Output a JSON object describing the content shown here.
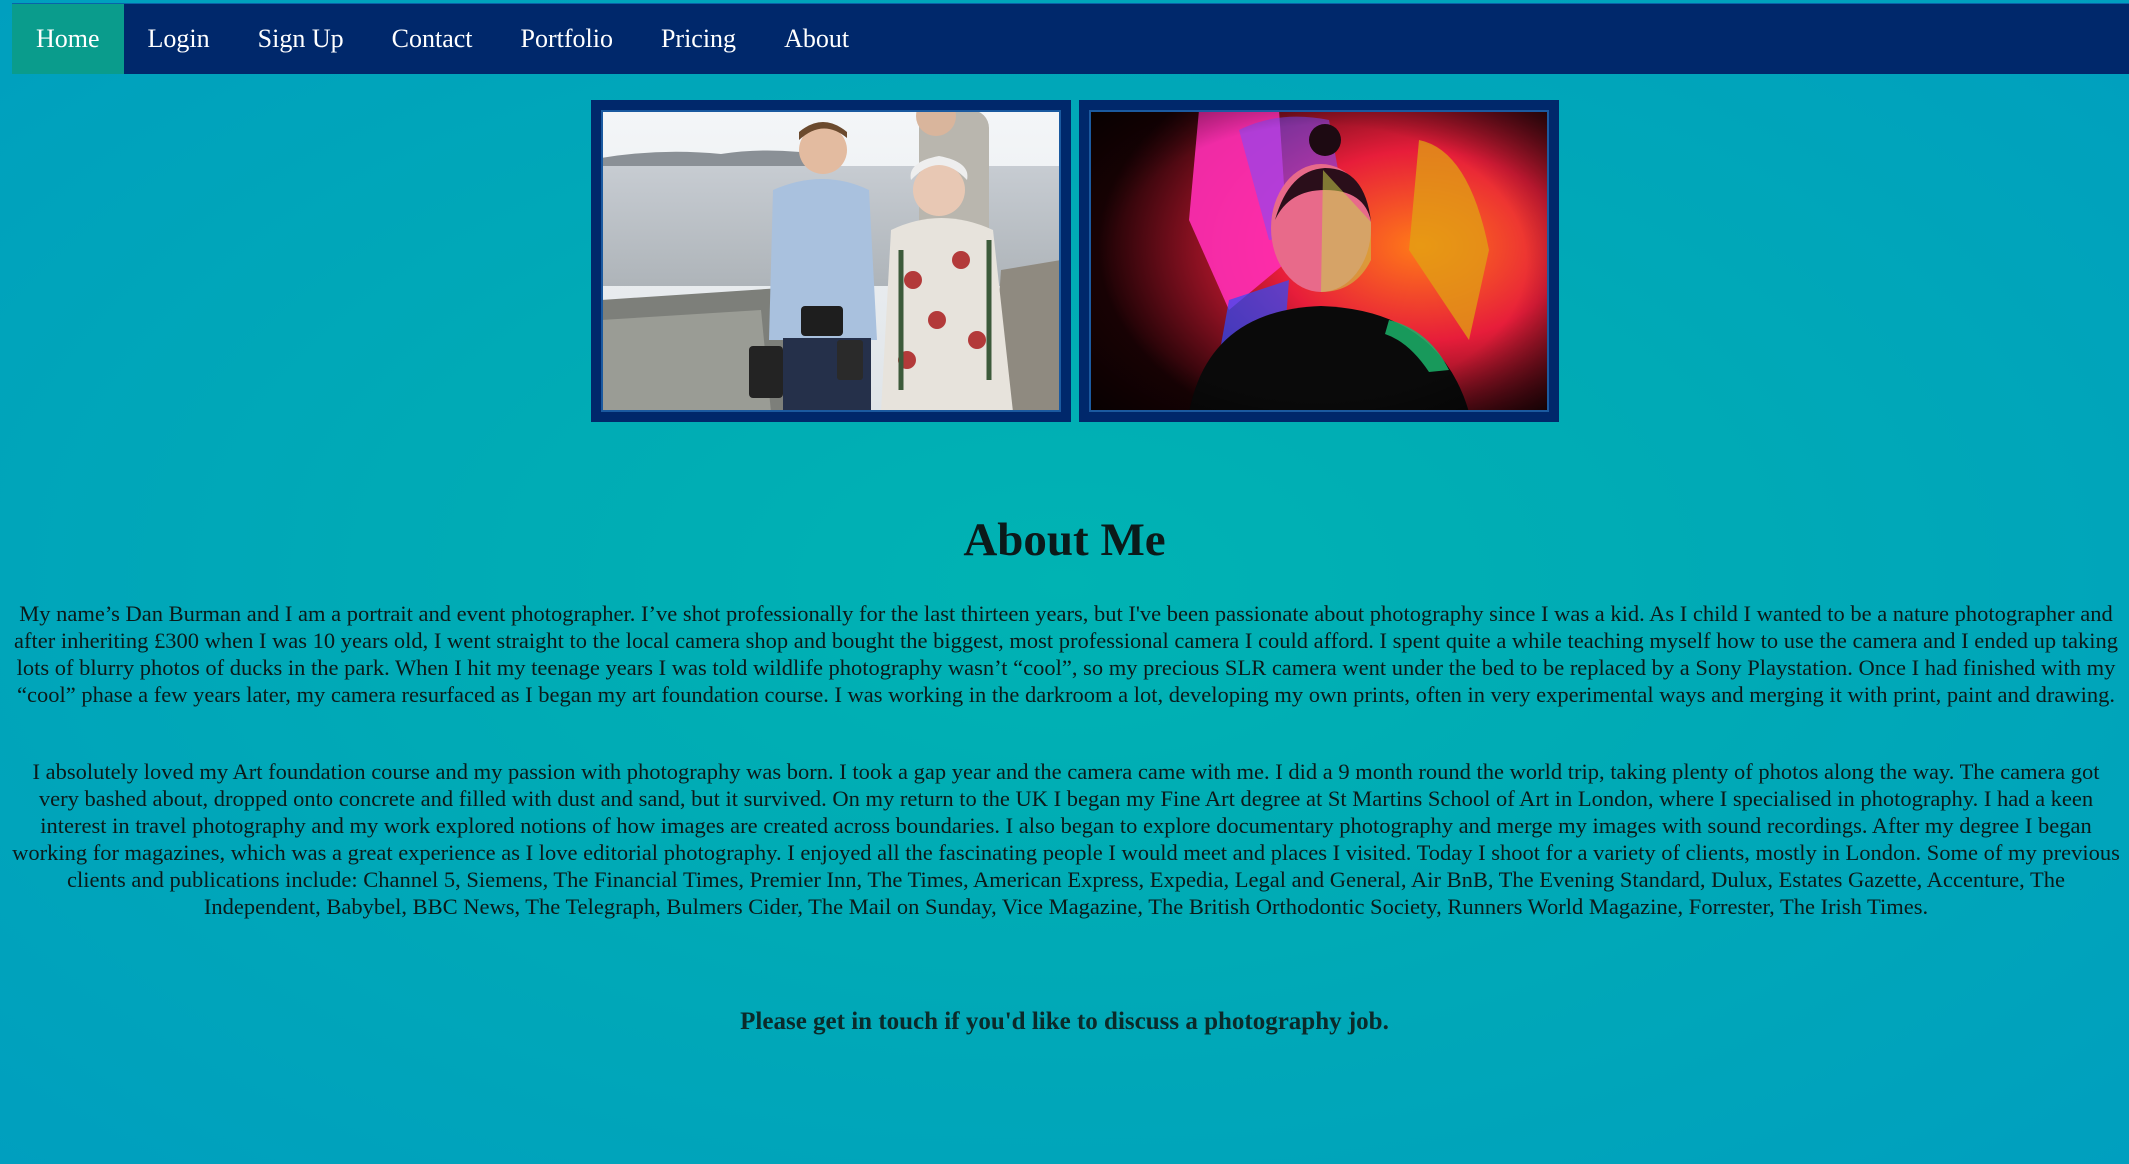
{
  "nav": {
    "items": [
      {
        "label": "Home",
        "active": true
      },
      {
        "label": "Login",
        "active": false
      },
      {
        "label": "Sign Up",
        "active": false
      },
      {
        "label": "Contact",
        "active": false
      },
      {
        "label": "Portfolio",
        "active": false
      },
      {
        "label": "Pricing",
        "active": false
      },
      {
        "label": "About",
        "active": false
      }
    ]
  },
  "colors": {
    "nav_background": "#00286b",
    "nav_active": "#0a9c8c",
    "page_background": "#00b3b3",
    "photo_border": "#00286b"
  },
  "photos": [
    {
      "name": "childhood-photo",
      "subject": "boy with camera beside elderly woman by the sea"
    },
    {
      "name": "portrait-photo",
      "subject": "man under colored lights"
    }
  ],
  "about": {
    "title": "About Me",
    "paragraphs": [
      "My name’s Dan Burman and I am a portrait and event photographer. I’ve shot professionally for the last thirteen years, but I've been passionate about photography since I was a kid. As I child I wanted to be a nature photographer and after inheriting £300 when I was 10 years old, I went straight to the local camera shop and bought the biggest, most professional camera I could afford. I spent quite a while teaching myself how to use the camera and I ended up taking lots of blurry photos of ducks in the park. When I hit my teenage years I was told wildlife photography wasn’t “cool”, so my precious SLR camera went under the bed to be replaced by a Sony Playstation. Once I had finished with my “cool” phase a few years later, my camera resurfaced as I began my art foundation course. I was working in the darkroom a lot, developing my own prints, often in very experimental ways and merging it with print, paint and drawing.",
      "I absolutely loved my Art foundation course and my passion with photography was born. I took a gap year and the camera came with me. I did a 9 month round the world trip, taking plenty of photos along the way. The camera got very bashed about, dropped onto concrete and filled with dust and sand, but it survived. On my return to the UK I began my Fine Art degree at St Martins School of Art in London, where I specialised in photography. I had a keen interest in travel photography and my work explored notions of how images are created across boundaries. I also began to explore documentary photography and merge my images with sound recordings. After my degree I began working for magazines, which was a great experience as I love editorial photography. I enjoyed all the fascinating people I would meet and places I visited. Today I shoot for a variety of clients, mostly in London. Some of my previous clients and publications include: Channel 5, Siemens, The Financial Times, Premier Inn, The Times, American Express, Expedia, Legal and General, Air BnB, The Evening Standard, Dulux, Estates Gazette, Accenture, The Independent, Babybel, BBC News, The Telegraph, Bulmers Cider, The Mail on Sunday, Vice Magazine, The British Orthodontic Society, Runners World Magazine, Forrester, The Irish Times."
    ],
    "cta": "Please get in touch if you'd like to discuss a photography job."
  }
}
